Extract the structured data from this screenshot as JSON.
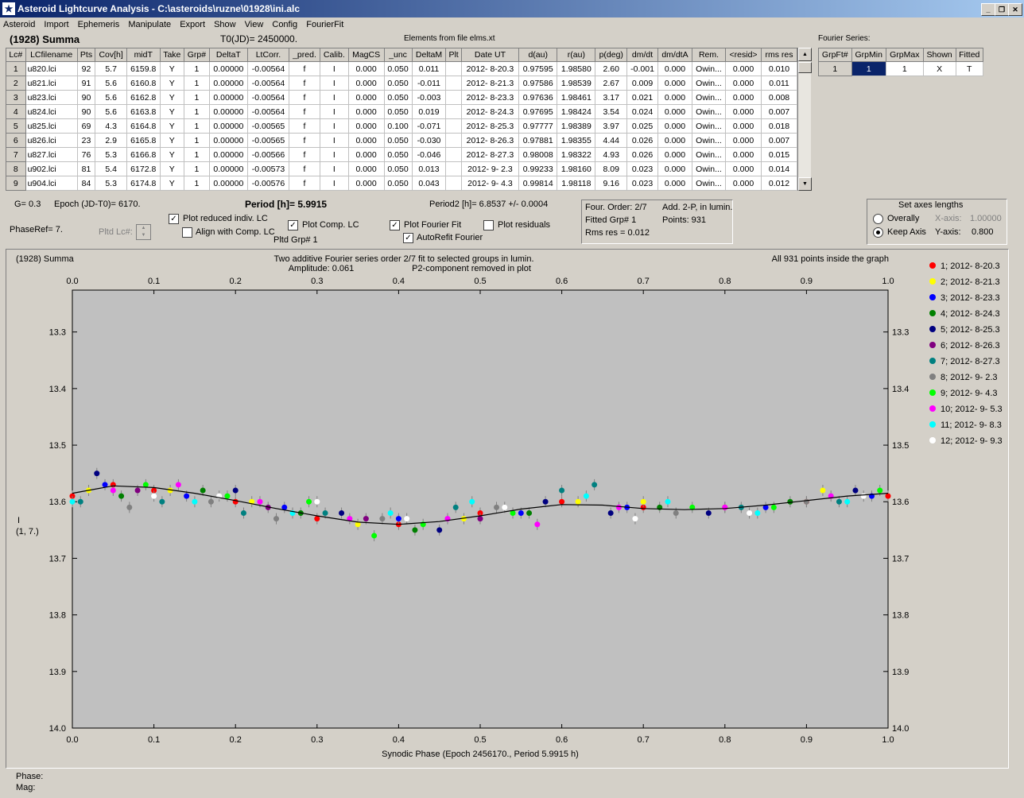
{
  "window": {
    "title": "Asteroid Lightcurve Analysis - C:\\asteroids\\ruzne\\01928\\ini.alc",
    "icon": "ALC"
  },
  "menu": [
    "Asteroid",
    "Import",
    "Ephemeris",
    "Manipulate",
    "Export",
    "Show",
    "View",
    "Config",
    "FourierFit"
  ],
  "header": {
    "asteroid": "(1928) Summa",
    "t0": "T0(JD)= 2450000.",
    "elements": "Elements from file elms.xt",
    "fourier_label": "Fourier Series:"
  },
  "lc_table": {
    "columns": [
      "Lc#",
      "LCfilename",
      "Pts",
      "Cov[h]",
      "midT",
      "Take",
      "Grp#",
      "DeltaT",
      "LtCorr.",
      "_pred.",
      "Calib.",
      "MagCS",
      "_unc",
      "DeltaM",
      "Plt",
      "Date UT",
      "d(au)",
      "r(au)",
      "p(deg)",
      "dm/dt",
      "dm/dtA",
      "Rem.",
      "<resid>",
      "rms res"
    ],
    "rows": [
      [
        "1",
        "u820.lci",
        "92",
        "5.7",
        "6159.8",
        "Y",
        "1",
        "0.00000",
        "-0.00564",
        "f",
        "I",
        "0.000",
        "0.050",
        "0.011",
        "",
        "2012- 8-20.3",
        "0.97595",
        "1.98580",
        "2.60",
        "-0.001",
        "0.000",
        "Owin...",
        "0.000",
        "0.010"
      ],
      [
        "2",
        "u821.lci",
        "91",
        "5.6",
        "6160.8",
        "Y",
        "1",
        "0.00000",
        "-0.00564",
        "f",
        "I",
        "0.000",
        "0.050",
        "-0.011",
        "",
        "2012- 8-21.3",
        "0.97586",
        "1.98539",
        "2.67",
        "0.009",
        "0.000",
        "Owin...",
        "0.000",
        "0.011"
      ],
      [
        "3",
        "u823.lci",
        "90",
        "5.6",
        "6162.8",
        "Y",
        "1",
        "0.00000",
        "-0.00564",
        "f",
        "I",
        "0.000",
        "0.050",
        "-0.003",
        "",
        "2012- 8-23.3",
        "0.97636",
        "1.98461",
        "3.17",
        "0.021",
        "0.000",
        "Owin...",
        "0.000",
        "0.008"
      ],
      [
        "4",
        "u824.lci",
        "90",
        "5.6",
        "6163.8",
        "Y",
        "1",
        "0.00000",
        "-0.00564",
        "f",
        "I",
        "0.000",
        "0.050",
        "0.019",
        "",
        "2012- 8-24.3",
        "0.97695",
        "1.98424",
        "3.54",
        "0.024",
        "0.000",
        "Owin...",
        "0.000",
        "0.007"
      ],
      [
        "5",
        "u825.lci",
        "69",
        "4.3",
        "6164.8",
        "Y",
        "1",
        "0.00000",
        "-0.00565",
        "f",
        "I",
        "0.000",
        "0.100",
        "-0.071",
        "",
        "2012- 8-25.3",
        "0.97777",
        "1.98389",
        "3.97",
        "0.025",
        "0.000",
        "Owin...",
        "0.000",
        "0.018"
      ],
      [
        "6",
        "u826.lci",
        "23",
        "2.9",
        "6165.8",
        "Y",
        "1",
        "0.00000",
        "-0.00565",
        "f",
        "I",
        "0.000",
        "0.050",
        "-0.030",
        "",
        "2012- 8-26.3",
        "0.97881",
        "1.98355",
        "4.44",
        "0.026",
        "0.000",
        "Owin...",
        "0.000",
        "0.007"
      ],
      [
        "7",
        "u827.lci",
        "76",
        "5.3",
        "6166.8",
        "Y",
        "1",
        "0.00000",
        "-0.00566",
        "f",
        "I",
        "0.000",
        "0.050",
        "-0.046",
        "",
        "2012- 8-27.3",
        "0.98008",
        "1.98322",
        "4.93",
        "0.026",
        "0.000",
        "Owin...",
        "0.000",
        "0.015"
      ],
      [
        "8",
        "u902.lci",
        "81",
        "5.4",
        "6172.8",
        "Y",
        "1",
        "0.00000",
        "-0.00573",
        "f",
        "I",
        "0.000",
        "0.050",
        "0.013",
        "",
        "2012- 9- 2.3",
        "0.99233",
        "1.98160",
        "8.09",
        "0.023",
        "0.000",
        "Owin...",
        "0.000",
        "0.014"
      ],
      [
        "9",
        "u904.lci",
        "84",
        "5.3",
        "6174.8",
        "Y",
        "1",
        "0.00000",
        "-0.00576",
        "f",
        "I",
        "0.000",
        "0.050",
        "0.043",
        "",
        "2012- 9- 4.3",
        "0.99814",
        "1.98118",
        "9.16",
        "0.023",
        "0.000",
        "Owin...",
        "0.000",
        "0.012"
      ]
    ]
  },
  "fourier_table": {
    "columns": [
      "GrpFt#",
      "GrpMin",
      "GrpMax",
      "Shown",
      "Fitted"
    ],
    "row": [
      "1",
      "1",
      "1",
      "X",
      "T"
    ]
  },
  "params": {
    "g": "G= 0.3",
    "epoch": "Epoch (JD-T0)= 6170.",
    "phaseref": "PhaseRef= 7.",
    "pltd_lc": "Pltd Lc#:",
    "period": "Period [h]= 5.9915",
    "period2": "Period2 [h]= 6.8537 +/- 0.0004",
    "pltd_grp": "Pltd Grp#  1",
    "cb_plot_reduced": "Plot reduced indiv. LC",
    "cb_align": "Align with Comp. LC",
    "cb_plot_comp": "Plot Comp. LC",
    "cb_plot_fourier": "Plot Fourier Fit",
    "cb_plot_resid": "Plot residuals",
    "cb_autorefit": "AutoRefit Fourier",
    "four_order": "Four. Order:  2/7",
    "add_2p": "Add. 2-P, in lumin.",
    "fitted_grp": "Fitted Grp# 1",
    "points": "Points: 931",
    "rms_res": "Rms res    = 0.012"
  },
  "axes_panel": {
    "title": "Set axes lengths",
    "overally": "Overally",
    "keep_axis": "Keep Axis",
    "x_label": "X-axis:",
    "x_val": "1.00000",
    "y_label": "Y-axis:",
    "y_val": "0.800"
  },
  "plot_header": {
    "name": "(1928) Summa",
    "desc1": "Two additive Fourier series order 2/7 fit to selected groups in lumin.",
    "amp": "Amplitude: 0.061",
    "p2": "P2-component removed in plot",
    "allpts": "All 931 points inside the graph",
    "ylab1": "I",
    "ylab2": "(1, 7.)"
  },
  "chart_data": {
    "type": "scatter",
    "xlabel": "Synodic Phase (Epoch 2456170., Period 5.9915 h)",
    "xlim": [
      0.0,
      1.0
    ],
    "ylim": [
      13.6,
      14.0
    ],
    "y_top": 13.226,
    "x_ticks": [
      "0.0",
      "0.1",
      "0.2",
      "0.3",
      "0.4",
      "0.5",
      "0.6",
      "0.7",
      "0.8",
      "0.9",
      "1.0"
    ],
    "y_ticks": [
      "13.3",
      "13.4",
      "13.5",
      "13.6",
      "13.7",
      "13.8",
      "13.9",
      "14.0"
    ],
    "fourier_fit": {
      "x": [
        0.0,
        0.05,
        0.1,
        0.15,
        0.2,
        0.25,
        0.3,
        0.35,
        0.4,
        0.45,
        0.5,
        0.55,
        0.6,
        0.65,
        0.7,
        0.75,
        0.8,
        0.85,
        0.9,
        0.95,
        1.0
      ],
      "y": [
        13.585,
        13.572,
        13.575,
        13.585,
        13.598,
        13.612,
        13.625,
        13.636,
        13.64,
        13.635,
        13.625,
        13.613,
        13.605,
        13.606,
        13.612,
        13.614,
        13.612,
        13.606,
        13.598,
        13.59,
        13.585
      ]
    },
    "series": [
      {
        "name": "1; 2012- 8-20.3",
        "color": "#ff0000",
        "x": [
          0.0,
          0.05,
          0.1,
          0.2,
          0.3,
          0.4,
          0.5,
          0.6,
          0.7,
          0.8,
          0.9,
          1.0
        ],
        "y": [
          13.59,
          13.57,
          13.58,
          13.6,
          13.63,
          13.64,
          13.62,
          13.6,
          13.61,
          13.61,
          13.6,
          13.59
        ]
      },
      {
        "name": "2; 2012- 8-21.3",
        "color": "#ffff00",
        "x": [
          0.02,
          0.12,
          0.22,
          0.35,
          0.48,
          0.62,
          0.7,
          0.92
        ],
        "y": [
          13.58,
          13.58,
          13.6,
          13.64,
          13.63,
          13.6,
          13.6,
          13.58
        ]
      },
      {
        "name": "3; 2012- 8-23.3",
        "color": "#0000ff",
        "x": [
          0.04,
          0.14,
          0.26,
          0.4,
          0.55,
          0.68,
          0.85,
          0.98
        ],
        "y": [
          13.57,
          13.59,
          13.61,
          13.63,
          13.62,
          13.61,
          13.61,
          13.59
        ]
      },
      {
        "name": "4; 2012- 8-24.3",
        "color": "#008000",
        "x": [
          0.06,
          0.16,
          0.28,
          0.42,
          0.56,
          0.72,
          0.88
        ],
        "y": [
          13.59,
          13.58,
          13.62,
          13.65,
          13.62,
          13.61,
          13.6
        ]
      },
      {
        "name": "5; 2012- 8-25.3",
        "color": "#000080",
        "x": [
          0.03,
          0.2,
          0.33,
          0.45,
          0.58,
          0.66,
          0.78,
          0.96
        ],
        "y": [
          13.55,
          13.58,
          13.62,
          13.65,
          13.6,
          13.62,
          13.62,
          13.58
        ]
      },
      {
        "name": "6; 2012- 8-26.3",
        "color": "#800080",
        "x": [
          0.08,
          0.24,
          0.36,
          0.5
        ],
        "y": [
          13.58,
          13.61,
          13.63,
          13.63
        ]
      },
      {
        "name": "7; 2012- 8-27.3",
        "color": "#008080",
        "x": [
          0.01,
          0.11,
          0.21,
          0.31,
          0.47,
          0.6,
          0.64,
          0.82,
          0.94
        ],
        "y": [
          13.6,
          13.6,
          13.62,
          13.62,
          13.61,
          13.58,
          13.57,
          13.61,
          13.6
        ]
      },
      {
        "name": "8; 2012- 9- 2.3",
        "color": "#808080",
        "x": [
          0.07,
          0.17,
          0.25,
          0.38,
          0.52,
          0.74,
          0.9
        ],
        "y": [
          13.61,
          13.6,
          13.63,
          13.63,
          13.61,
          13.62,
          13.6
        ]
      },
      {
        "name": "9; 2012- 9- 4.3",
        "color": "#00ff00",
        "x": [
          0.09,
          0.19,
          0.29,
          0.37,
          0.43,
          0.54,
          0.76,
          0.86,
          0.99
        ],
        "y": [
          13.57,
          13.59,
          13.6,
          13.66,
          13.64,
          13.62,
          13.61,
          13.61,
          13.58
        ]
      },
      {
        "name": "10; 2012- 9- 5.3",
        "color": "#ff00ff",
        "x": [
          0.05,
          0.13,
          0.23,
          0.34,
          0.46,
          0.57,
          0.67,
          0.8,
          0.93
        ],
        "y": [
          13.58,
          13.57,
          13.6,
          13.63,
          13.63,
          13.64,
          13.61,
          13.61,
          13.59
        ]
      },
      {
        "name": "11; 2012- 9- 8.3",
        "color": "#00ffff",
        "x": [
          0.0,
          0.15,
          0.27,
          0.39,
          0.49,
          0.63,
          0.73,
          0.84,
          0.95
        ],
        "y": [
          13.6,
          13.6,
          13.62,
          13.62,
          13.6,
          13.59,
          13.6,
          13.62,
          13.6
        ]
      },
      {
        "name": "12; 2012- 9- 9.3",
        "color": "#ffffff",
        "x": [
          0.1,
          0.18,
          0.3,
          0.41,
          0.53,
          0.69,
          0.83,
          0.97
        ],
        "y": [
          13.59,
          13.59,
          13.6,
          13.63,
          13.61,
          13.63,
          13.62,
          13.59
        ]
      }
    ]
  },
  "status": {
    "phase": "Phase:",
    "mag": "Mag:"
  }
}
